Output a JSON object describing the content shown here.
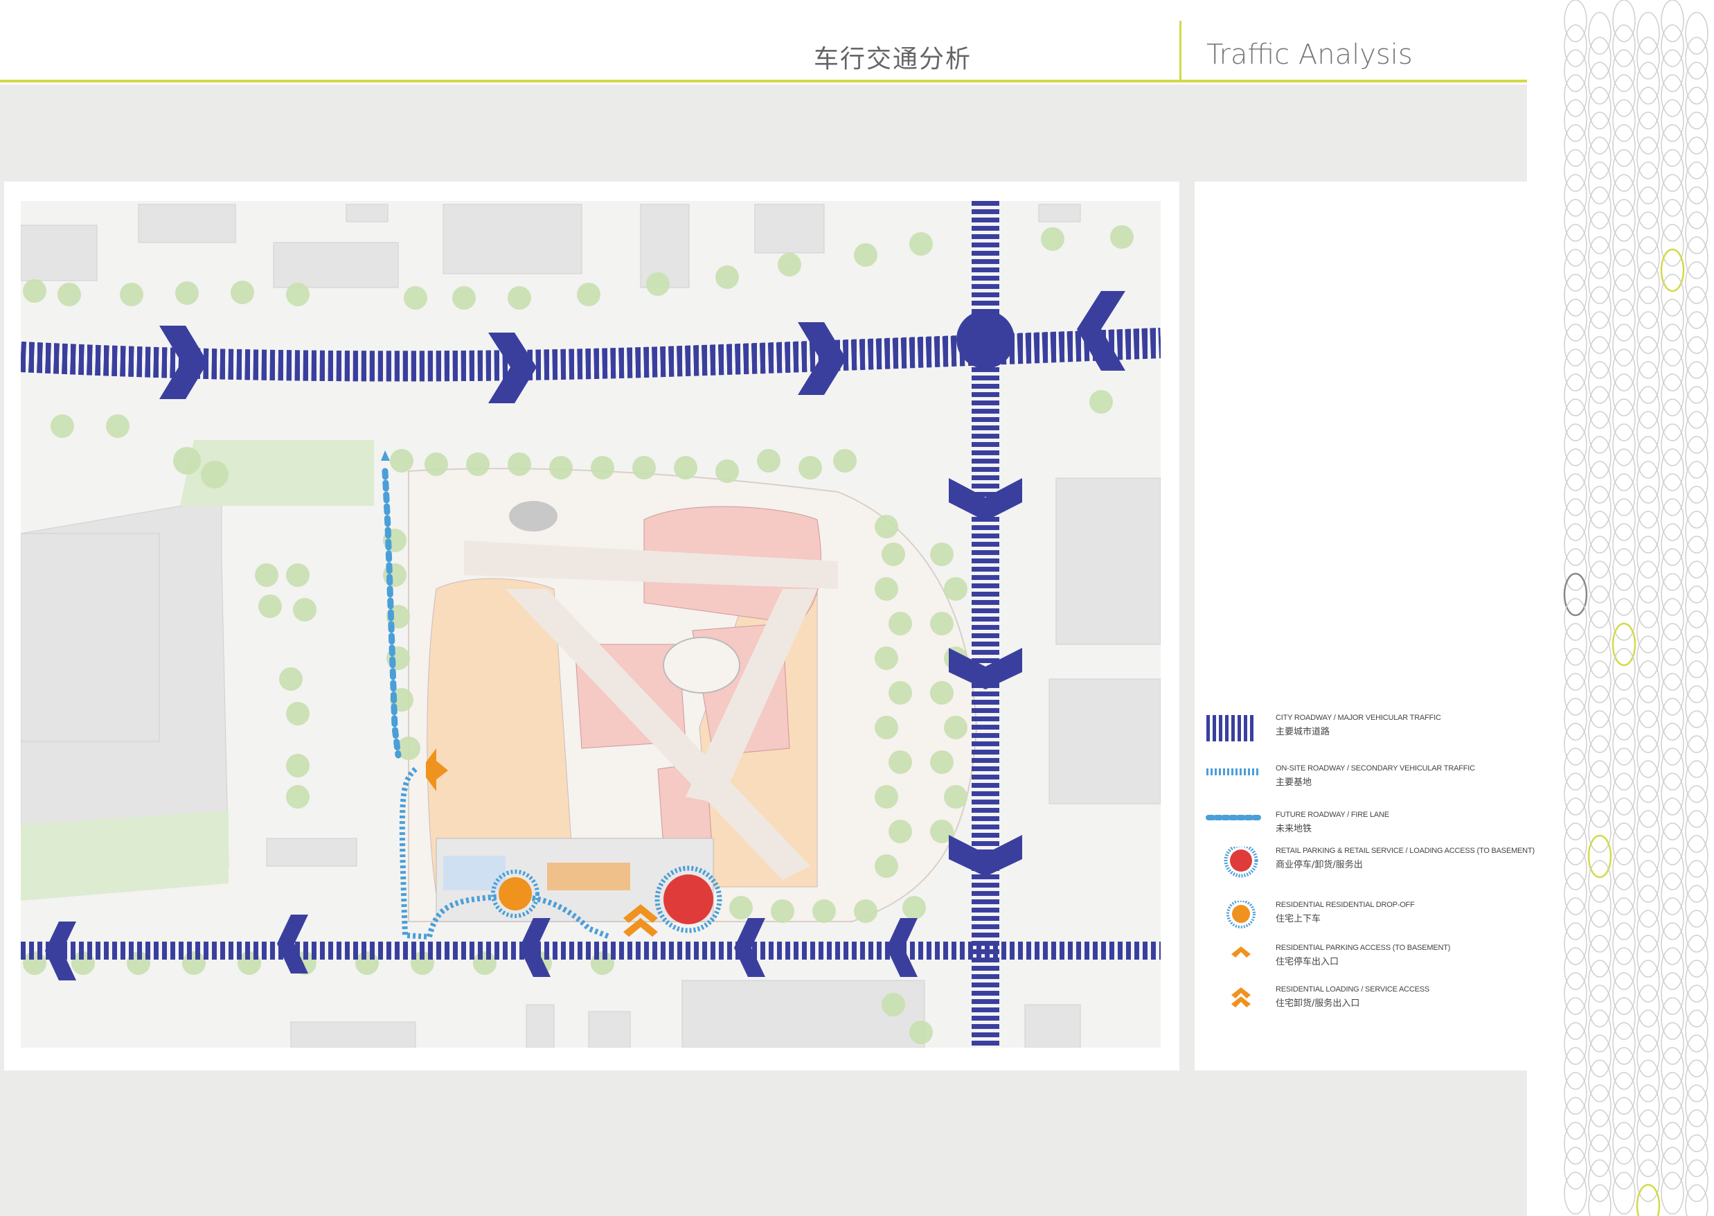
{
  "header": {
    "title_cn": "车行交通分析",
    "title_en": "Traffic Analysis"
  },
  "colors": {
    "city_road": "#3a3f9e",
    "onsite_road": "#4a9fd8",
    "retail_marker": "#e03b3b",
    "residential_marker": "#f0921e",
    "accent": "#d3d94a",
    "shop_pink": "#f5c9c4",
    "shop_orange": "#f8dcbc",
    "tree": "#c8e0b0"
  },
  "legend": [
    {
      "icon": "city-roadway-icon",
      "en": "CITY ROADWAY / MAJOR VEHICULAR TRAFFIC",
      "cn": "主要城市道路"
    },
    {
      "icon": "onsite-roadway-icon",
      "en": "ON-SITE  ROADWAY / SECONDARY VEHICULAR TRAFFIC",
      "cn": "主要基地"
    },
    {
      "icon": "future-roadway-icon",
      "en": "FUTURE ROADWAY / FIRE LANE",
      "cn": "未来地铁"
    },
    {
      "icon": "retail-parking-icon",
      "en": "RETAIL PARKING & RETAIL SERVICE / LOADING ACCESS (TO BASEMENT)",
      "cn": "商业停车/卸货/服务出"
    },
    {
      "icon": "residential-dropoff-icon",
      "en": "RESIDENTIAL RESIDENTIAL DROP-OFF",
      "cn": "住宅上下车"
    },
    {
      "icon": "residential-parking-icon",
      "en": "RESIDENTIAL PARKING ACCESS (TO BASEMENT)",
      "cn": "住宅停车出入口"
    },
    {
      "icon": "residential-loading-icon",
      "en": "RESIDENTIAL LOADING / SERVICE ACCESS",
      "cn": "住宅卸货/服务出入口"
    }
  ]
}
